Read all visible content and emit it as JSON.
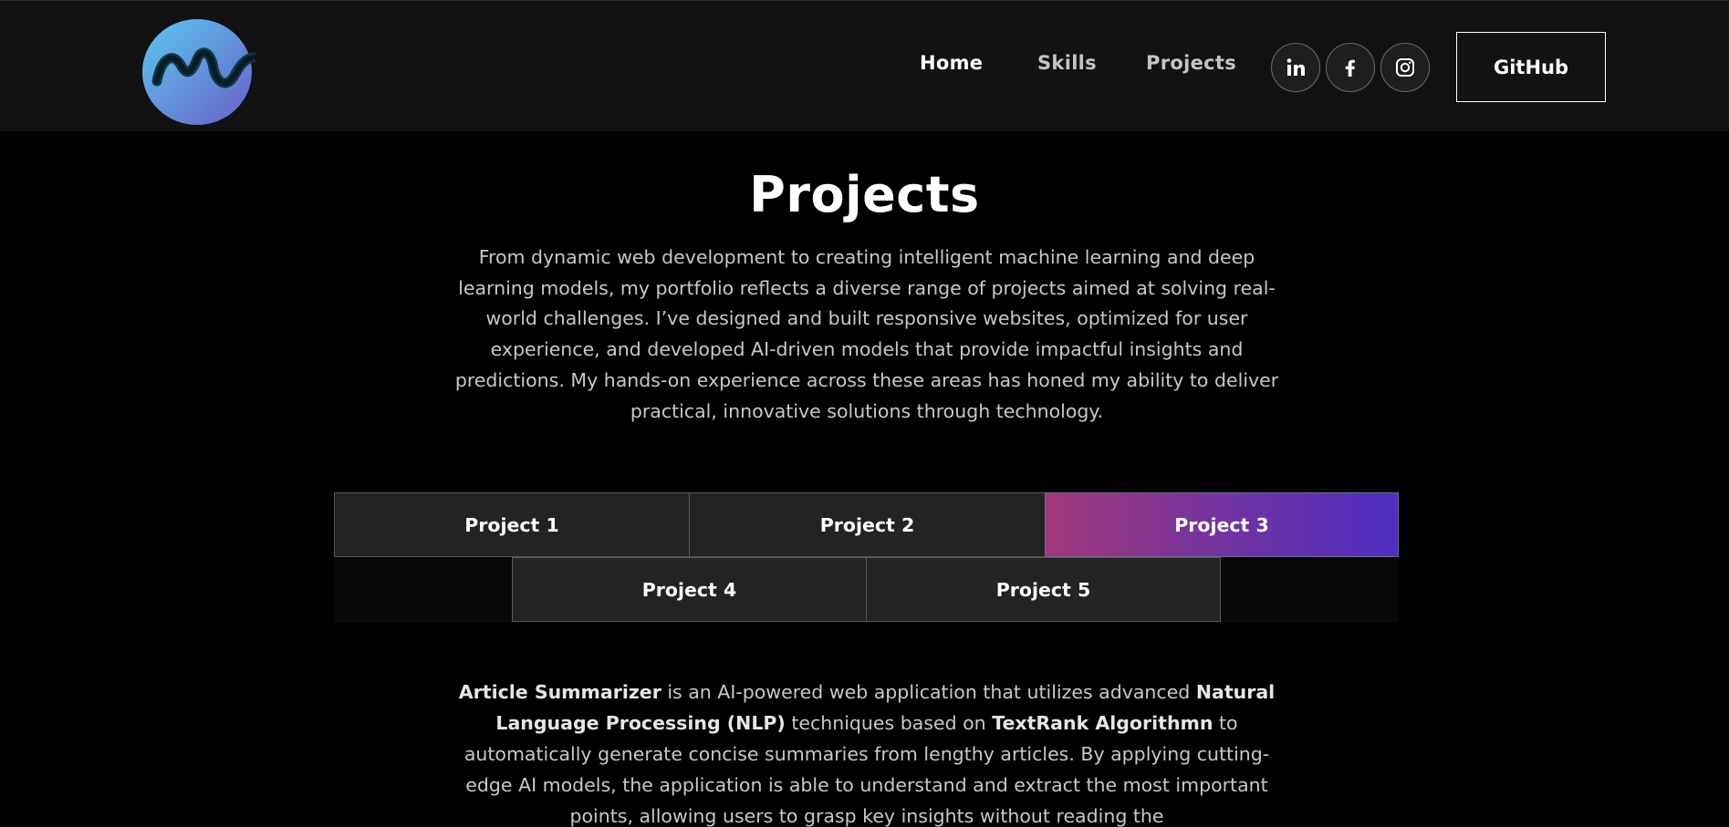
{
  "nav": {
    "links": [
      "Home",
      "Skills",
      "Projects"
    ],
    "social": [
      "linkedin-icon",
      "facebook-icon",
      "instagram-icon"
    ],
    "github_label": "GitHub"
  },
  "main": {
    "title": "Projects",
    "intro": "From dynamic web development to creating intelligent machine learning and deep learning models, my portfolio reflects a diverse range of projects aimed at solving real-world challenges. I’ve designed and built responsive websites, optimized for user experience, and developed AI-driven models that provide impactful insights and predictions. My hands-on experience across these areas has honed my ability to deliver practical, innovative solutions through technology.",
    "tabs": [
      "Project 1",
      "Project 2",
      "Project 3",
      "Project 4",
      "Project 5"
    ],
    "active_tab": "Project 3",
    "description": {
      "name": "Article Summarizer",
      "text1": " is an AI-powered web application that utilizes advanced ",
      "nlp": "Natural Language Processing (NLP)",
      "text2": " techniques based on ",
      "algo": "TextRank Algorithmn",
      "text3": " to automatically generate concise summaries from lengthy articles. By applying cutting-edge AI models, the application is able to understand and extract the most important points, allowing users to grasp key insights without reading the"
    }
  },
  "colors": {
    "background": "#000000",
    "navbar": "#121212",
    "tab": "#232323",
    "active_gradient_start": "#a23778",
    "active_gradient_end": "#4e2dc0"
  }
}
